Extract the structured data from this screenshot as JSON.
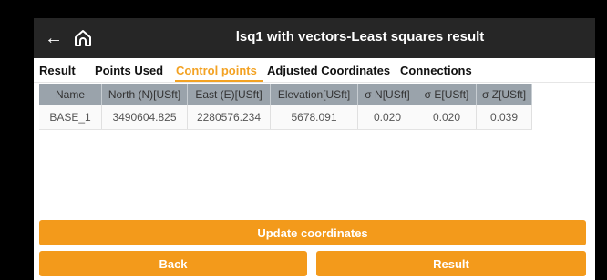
{
  "appbar": {
    "title": "lsq1 with vectors-Least squares result"
  },
  "tabs": [
    {
      "label": "Result",
      "active": false
    },
    {
      "label": "Points Used",
      "active": false
    },
    {
      "label": "Control points",
      "active": true
    },
    {
      "label": "Adjusted Coordinates",
      "active": false
    },
    {
      "label": "Connections",
      "active": false
    }
  ],
  "table": {
    "headers": [
      "Name",
      "North (N)[USft]",
      "East (E)[USft]",
      "Elevation[USft]",
      "σ N[USft]",
      "σ E[USft]",
      "σ Z[USft]"
    ],
    "rows": [
      [
        "BASE_1",
        "3490604.825",
        "2280576.234",
        "5678.091",
        "0.020",
        "0.020",
        "0.039"
      ]
    ]
  },
  "buttons": {
    "update": "Update coordinates",
    "back": "Back",
    "result": "Result"
  },
  "colors": {
    "accent": "#f39a1b",
    "appbar": "#262626",
    "table_header": "#9aa3ab"
  }
}
